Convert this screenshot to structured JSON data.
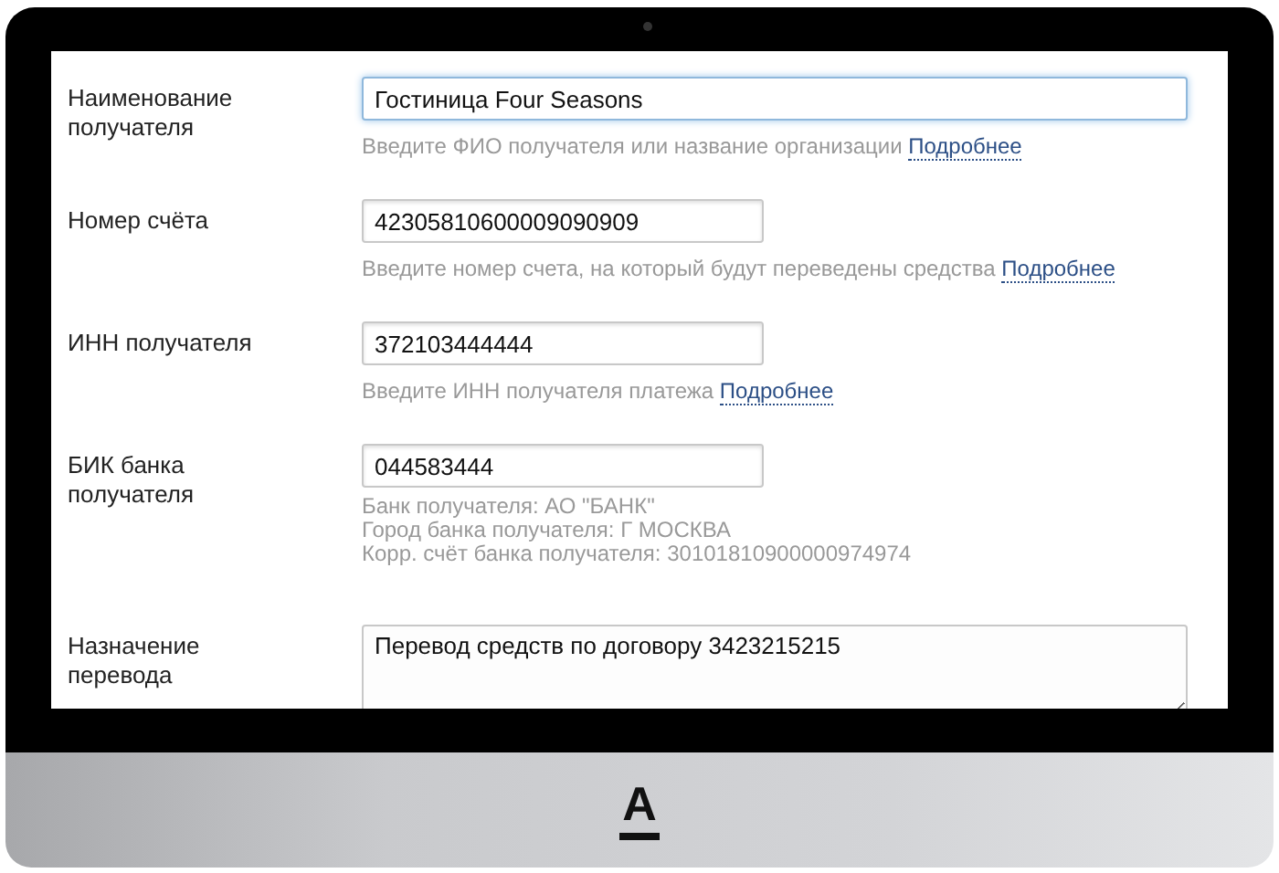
{
  "form": {
    "rows": [
      {
        "label": "Наименование получателя",
        "kind": "wide",
        "value": "Гостиница Four Seasons",
        "focused": true,
        "hint": "Введите ФИО получателя или название организации",
        "link": "Подробнее"
      },
      {
        "label": "Номер счёта",
        "kind": "narrow",
        "value": "42305810600009090909",
        "focused": false,
        "hint": "Введите номер счета, на который будут переведены средства",
        "link": "Подробнее"
      },
      {
        "label": "ИНН получателя",
        "kind": "narrow",
        "value": "372103444444",
        "focused": false,
        "hint": "Введите ИНН получателя платежа",
        "link": "Подробнее"
      },
      {
        "label": "БИК банка получателя",
        "kind": "narrow",
        "value": "044583444",
        "focused": false,
        "info": [
          "Банк получателя: АО \"БАНК\"",
          "Город банка получателя: Г МОСКВА",
          "Корр. счёт банка получателя: 30101810900000974974"
        ]
      },
      {
        "label": "Назначение перевода",
        "kind": "textarea",
        "value": "Перевод средств по договору 3423215215",
        "focused": false
      }
    ]
  },
  "logo": {
    "text": "А"
  }
}
